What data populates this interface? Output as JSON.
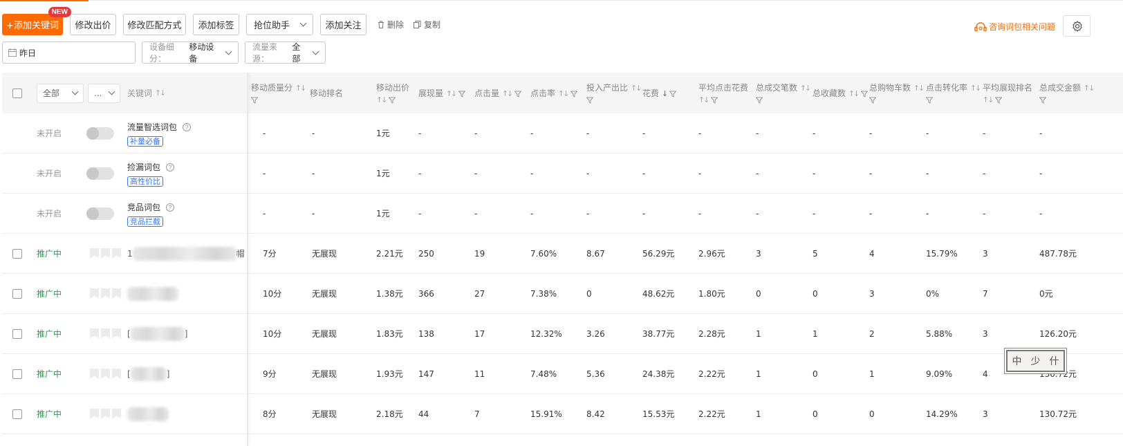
{
  "toolbar": {
    "add_keyword": "+添加关键词",
    "new_badge": "NEW",
    "modify_bid": "修改出价",
    "modify_match": "修改匹配方式",
    "add_tag": "添加标签",
    "rank_helper": "抢位助手",
    "add_follow": "添加关注",
    "delete": "删除",
    "copy": "复制",
    "consult": "咨询词包相关问题"
  },
  "filters": {
    "date": "昨日",
    "device_label": "设备细分：",
    "device_value": "移动设备",
    "traffic_label": "流量来源：",
    "traffic_value": "全部"
  },
  "columns": {
    "status_select": "全部",
    "second_select": "...",
    "keyword": "关键词",
    "quality": "移动质量分",
    "rank": "移动排名",
    "bid": "移动出价",
    "impressions": "展现量",
    "clicks": "点击量",
    "ctr": "点击率",
    "roi": "投入产出比",
    "cost": "花费",
    "cpc": "平均点击花费",
    "orders": "总成交笔数",
    "favorites": "总收藏数",
    "carts": "总购物车数",
    "cvr": "点击转化率",
    "avg_rank": "平均展现排名",
    "gmv": "总成交金额"
  },
  "packs": [
    {
      "status": "未开启",
      "name": "流量智选词包",
      "tag": "补量必备",
      "quality": "-",
      "rank": "-",
      "bid": "1元",
      "impressions": "-",
      "clicks": "-",
      "ctr": "-",
      "roi": "-",
      "cost": "-",
      "cpc": "-",
      "orders": "-",
      "favorites": "-",
      "carts": "-",
      "cvr": "-",
      "avg_rank": "-",
      "gmv": "-"
    },
    {
      "status": "未开启",
      "name": "捡漏词包",
      "tag": "高性价比",
      "quality": "-",
      "rank": "-",
      "bid": "1元",
      "impressions": "-",
      "clicks": "-",
      "ctr": "-",
      "roi": "-",
      "cost": "-",
      "cpc": "-",
      "orders": "-",
      "favorites": "-",
      "carts": "-",
      "cvr": "-",
      "avg_rank": "-",
      "gmv": "-"
    },
    {
      "status": "未开启",
      "name": "竞品词包",
      "tag": "竞品拦截",
      "quality": "-",
      "rank": "-",
      "bid": "1元",
      "impressions": "-",
      "clicks": "-",
      "ctr": "-",
      "roi": "-",
      "cost": "-",
      "cpc": "-",
      "orders": "-",
      "favorites": "-",
      "carts": "-",
      "cvr": "-",
      "avg_rank": "-",
      "gmv": "-"
    }
  ],
  "keywords": [
    {
      "status": "推广中",
      "kw_start": "1",
      "kw_end": "帽",
      "quality": "7分",
      "rank": "无展现",
      "bid": "2.21元",
      "impressions": "250",
      "clicks": "19",
      "ctr": "7.60%",
      "roi": "8.67",
      "cost": "56.29元",
      "cpc": "2.96元",
      "orders": "3",
      "favorites": "5",
      "carts": "4",
      "cvr": "15.79%",
      "avg_rank": "3",
      "gmv": "487.78元"
    },
    {
      "status": "推广中",
      "kw_start": "",
      "kw_end": "",
      "quality": "10分",
      "rank": "无展现",
      "bid": "1.38元",
      "impressions": "366",
      "clicks": "27",
      "ctr": "7.38%",
      "roi": "0",
      "cost": "48.62元",
      "cpc": "1.80元",
      "orders": "0",
      "favorites": "0",
      "carts": "3",
      "cvr": "0%",
      "avg_rank": "7",
      "gmv": "0元"
    },
    {
      "status": "推广中",
      "kw_start": "[",
      "kw_end": "]",
      "quality": "10分",
      "rank": "无展现",
      "bid": "1.83元",
      "impressions": "138",
      "clicks": "17",
      "ctr": "12.32%",
      "roi": "3.26",
      "cost": "38.77元",
      "cpc": "2.28元",
      "orders": "1",
      "favorites": "1",
      "carts": "2",
      "cvr": "5.88%",
      "avg_rank": "3",
      "gmv": "126.20元"
    },
    {
      "status": "推广中",
      "kw_start": "[",
      "kw_end": "]",
      "quality": "9分",
      "rank": "无展现",
      "bid": "1.93元",
      "impressions": "147",
      "clicks": "11",
      "ctr": "7.48%",
      "roi": "5.36",
      "cost": "24.38元",
      "cpc": "2.22元",
      "orders": "1",
      "favorites": "0",
      "carts": "1",
      "cvr": "9.09%",
      "avg_rank": "4",
      "gmv": "130.72元"
    },
    {
      "status": "推广中",
      "kw_start": "",
      "kw_end": "",
      "quality": "8分",
      "rank": "无展现",
      "bid": "2.18元",
      "impressions": "44",
      "clicks": "7",
      "ctr": "15.91%",
      "roi": "8.42",
      "cost": "15.53元",
      "cpc": "2.22元",
      "orders": "1",
      "favorites": "0",
      "carts": "0",
      "cvr": "14.29%",
      "avg_rank": "3",
      "gmv": "130.72元"
    }
  ],
  "stamp": [
    "中",
    "少",
    "什"
  ],
  "colors": {
    "accent": "#ff6a00",
    "active_status": "#22a04b",
    "tag_blue": "#3377ff"
  }
}
